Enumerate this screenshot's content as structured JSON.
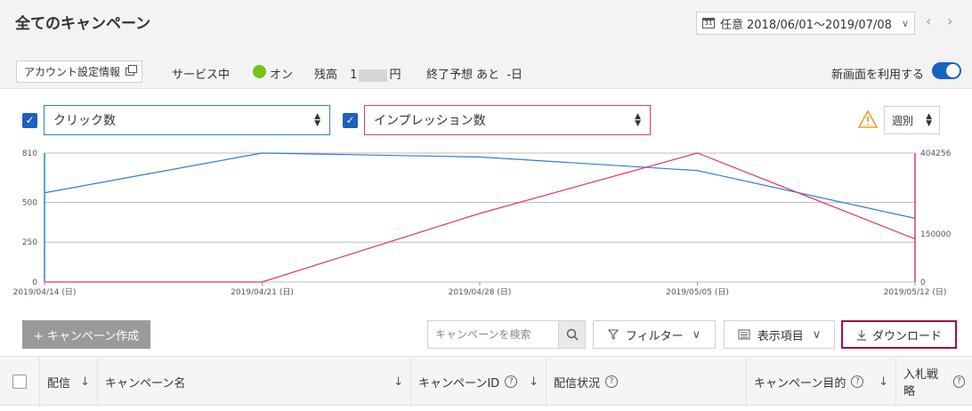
{
  "header": {
    "title": "全てのキャンペーン",
    "date_prefix": "任意",
    "date_range": "2018/06/01〜2019/07/08"
  },
  "info_bar": {
    "account_settings_label": "アカウント設定情報",
    "service_label": "サービス中",
    "service_status": "オン",
    "balance_label": "残高",
    "balance_prefix": "1",
    "balance_suffix": "円",
    "forecast_label": "終了予想 あと",
    "forecast_value": "-日",
    "new_ui_label": "新画面を利用する",
    "new_ui_enabled": true
  },
  "metrics": {
    "primary": {
      "label": "クリック数",
      "checked": true,
      "color": "#2a7fd4"
    },
    "secondary": {
      "label": "インプレッション数",
      "checked": true,
      "color": "#e0385f"
    },
    "period_label": "週別"
  },
  "chart_data": {
    "type": "line",
    "x": [
      "2019/04/14 (日)",
      "2019/04/21 (日)",
      "2019/04/28 (日)",
      "2019/05/05 (日)",
      "2019/05/12 (日)"
    ],
    "left_axis": {
      "ylim": [
        0,
        810
      ],
      "ticks": [
        "0",
        "250",
        "500",
        "810"
      ]
    },
    "right_axis": {
      "ylim": [
        0,
        404256
      ],
      "ticks": [
        "0",
        "150000",
        "404256"
      ]
    },
    "series": [
      {
        "name": "クリック数",
        "axis": "left",
        "color": "#2a7fd4",
        "values": [
          560,
          810,
          785,
          700,
          400
        ]
      },
      {
        "name": "インプレッション数",
        "axis": "right",
        "color": "#e0385f",
        "values": [
          0,
          0,
          215000,
          404256,
          135000
        ]
      }
    ],
    "grid": true
  },
  "toolbar": {
    "create_label": "+ キャンペーン作成",
    "search_placeholder": "キャンペーンを検索",
    "filter_label": "フィルター",
    "columns_label": "表示項目",
    "download_label": "ダウンロード"
  },
  "table": {
    "columns": [
      {
        "label": "配信",
        "sort": "↓"
      },
      {
        "label": "キャンペーン名",
        "sort": "↓"
      },
      {
        "label": "キャンペーンID",
        "sort": "↓",
        "help": "?"
      },
      {
        "label": "配信状況",
        "help": "?"
      },
      {
        "label": "キャンペーン目的",
        "sort": "↓",
        "help": "?"
      },
      {
        "label": "入札戦略",
        "help": "?"
      }
    ]
  }
}
